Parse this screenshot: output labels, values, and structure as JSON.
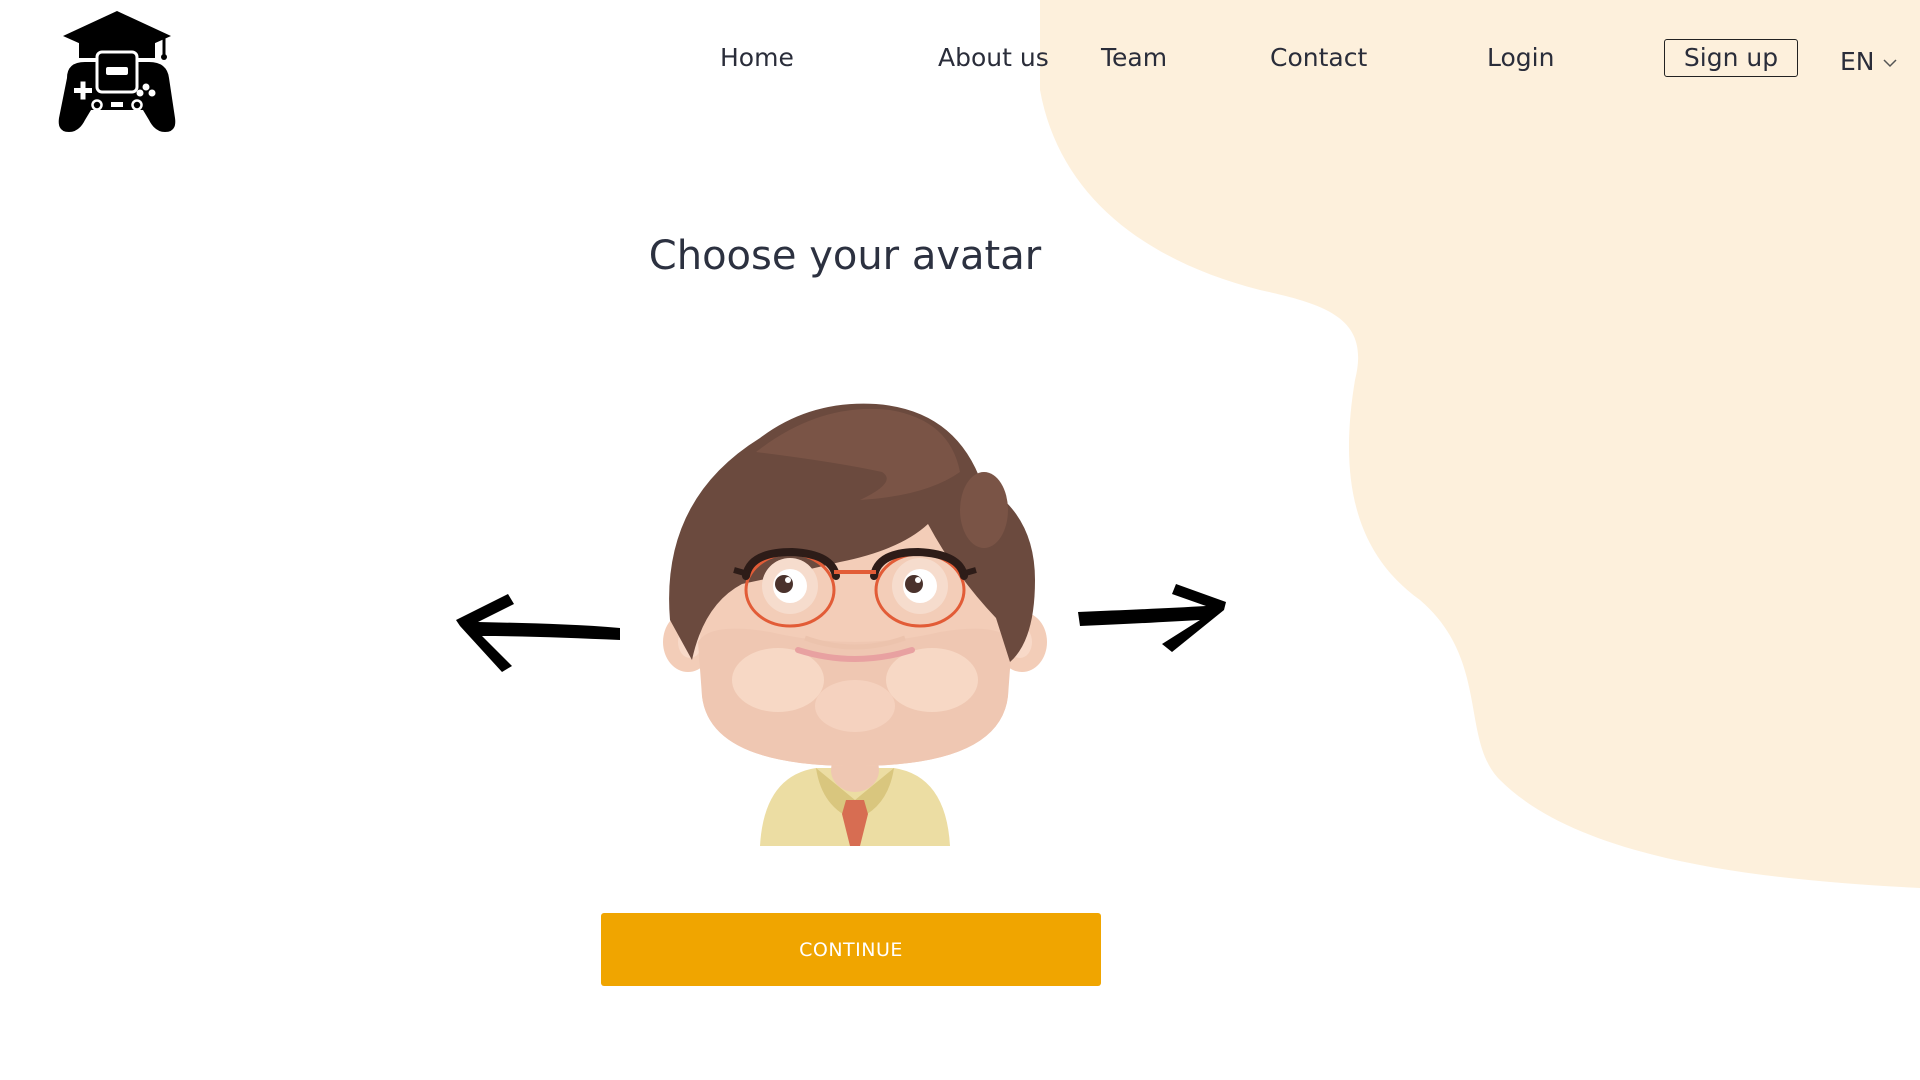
{
  "colors": {
    "accent": "#f0a500",
    "blob": "#fdf0dc",
    "text": "#2a2d3a"
  },
  "logo": {
    "icon": "graduation-cap-gamepad-icon"
  },
  "nav": {
    "home": "Home",
    "about": "About us",
    "team": "Team",
    "contact": "Contact",
    "login": "Login",
    "signup": "Sign up",
    "language": "EN"
  },
  "main": {
    "title": "Choose your avatar",
    "prev_icon": "arrow-left-icon",
    "next_icon": "arrow-right-icon",
    "avatar": "man-with-glasses-avatar",
    "continue_label": "CONTINUE"
  }
}
